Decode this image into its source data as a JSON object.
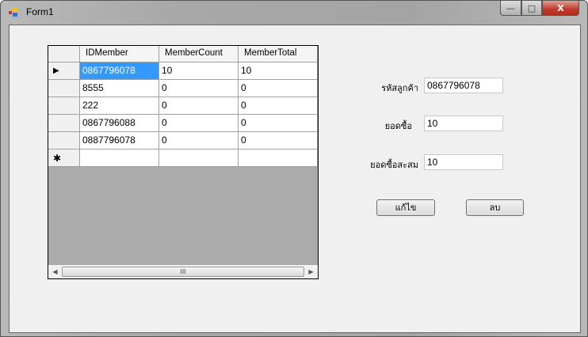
{
  "window": {
    "title": "Form1",
    "minimize": "—",
    "maximize": "□",
    "close": "X"
  },
  "grid": {
    "columns": [
      "IDMember",
      "MemberCount",
      "MemberTotal"
    ],
    "rows": [
      [
        "0867796078",
        "10",
        "10"
      ],
      [
        "8555",
        "0",
        "0"
      ],
      [
        "222",
        "0",
        "0"
      ],
      [
        "0867796088",
        "0",
        "0"
      ],
      [
        "0887796078",
        "0",
        "0"
      ]
    ],
    "current_row_marker": "▶",
    "new_row_marker": "✱",
    "scroll": {
      "left": "◀",
      "right": "▶",
      "thumb": "III"
    }
  },
  "form": {
    "customer_id_label": "รหัสลูกค้า",
    "customer_id_value": "0867796078",
    "purchase_label": "ยอดซื้อ",
    "purchase_value": "10",
    "total_label": "ยอดซื้อสะสม",
    "total_value": "10",
    "edit_button": "แก้ไข",
    "delete_button": "ลบ"
  }
}
